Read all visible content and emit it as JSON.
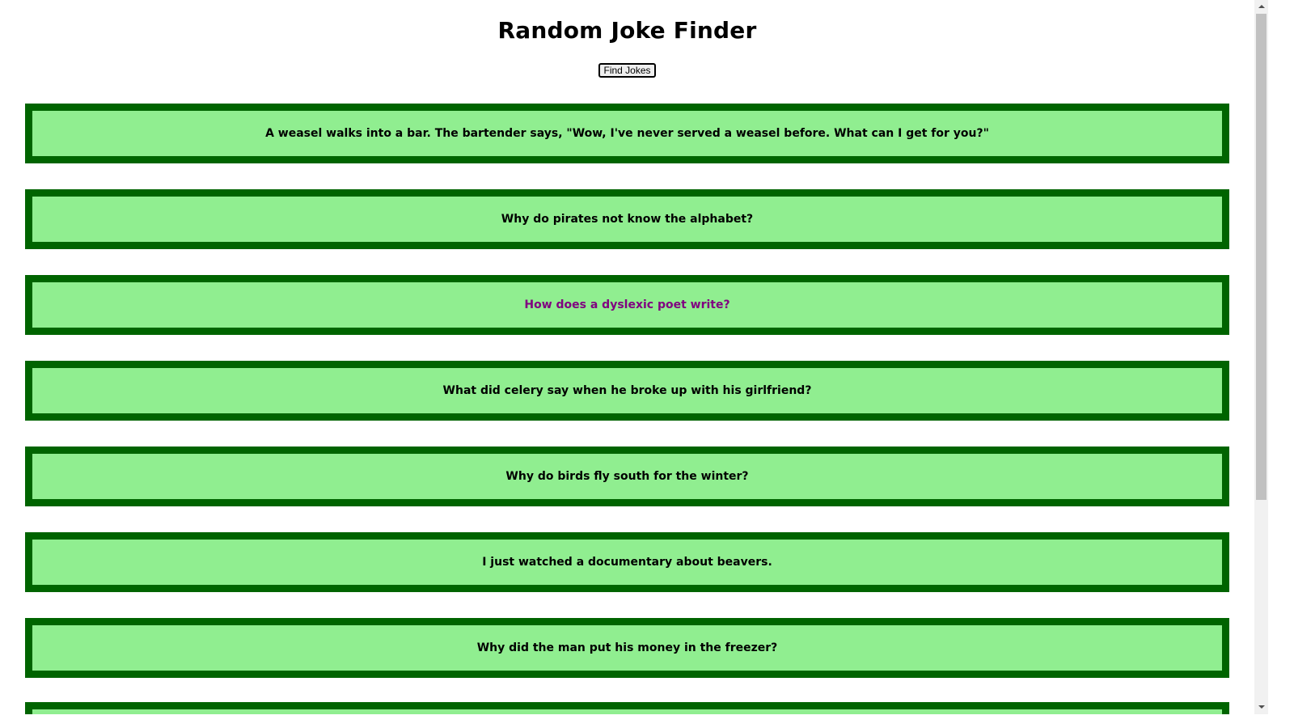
{
  "page": {
    "title": "Random Joke Finder",
    "find_button_label": "Find Jokes"
  },
  "jokes": [
    {
      "setup": "A weasel walks into a bar. The bartender says, \"Wow, I've never served a weasel before. What can I get for you?\"",
      "visited": false
    },
    {
      "setup": "Why do pirates not know the alphabet?",
      "visited": false
    },
    {
      "setup": "How does a dyslexic poet write?",
      "visited": true
    },
    {
      "setup": "What did celery say when he broke up with his girlfriend?",
      "visited": false
    },
    {
      "setup": "Why do birds fly south for the winter?",
      "visited": false
    },
    {
      "setup": "I just watched a documentary about beavers.",
      "visited": false
    },
    {
      "setup": "Why did the man put his money in the freezer?",
      "visited": false
    }
  ],
  "colors": {
    "card_background": "#90ee90",
    "card_border": "#006400",
    "visited_text": "#800080",
    "text": "#000000"
  },
  "scrollbar": {
    "scroll_position": 0.0
  }
}
